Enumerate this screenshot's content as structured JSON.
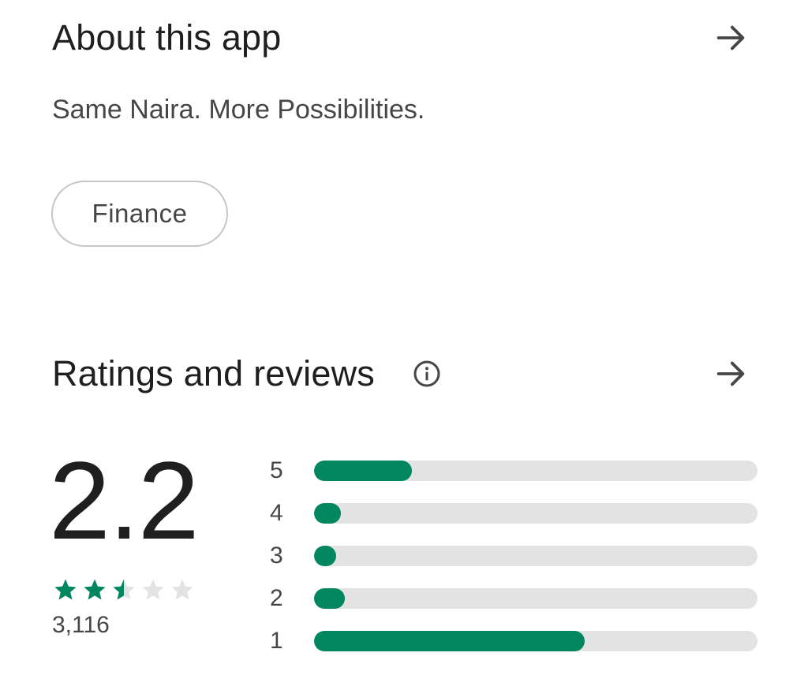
{
  "about": {
    "title": "About this app",
    "tagline": "Same Naira. More Possibilities.",
    "category_chip": "Finance",
    "arrow_icon": "arrow-right-icon"
  },
  "ratings": {
    "title": "Ratings and reviews",
    "info_icon": "info-icon",
    "arrow_icon": "arrow-right-icon",
    "score": "2.2",
    "stars_filled": 2.5,
    "stars_total": 5,
    "review_count": "3,116",
    "accent_color": "#01875f",
    "track_color": "#e3e3e3",
    "distribution": [
      {
        "label": "5",
        "fraction": 0.22
      },
      {
        "label": "4",
        "fraction": 0.06
      },
      {
        "label": "3",
        "fraction": 0.05
      },
      {
        "label": "2",
        "fraction": 0.07
      },
      {
        "label": "1",
        "fraction": 0.61
      }
    ]
  }
}
